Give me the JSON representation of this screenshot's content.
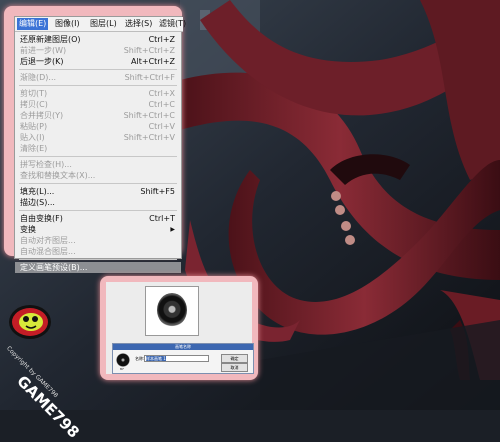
{
  "menubar": {
    "items": [
      {
        "label": "编辑(E)",
        "active": true
      },
      {
        "label": "图像(I)",
        "active": false
      },
      {
        "label": "图层(L)",
        "active": false
      },
      {
        "label": "选择(S)",
        "active": false
      },
      {
        "label": "滤镜(T)",
        "active": false
      }
    ]
  },
  "menu": {
    "items": [
      {
        "label": "还原新建图层(O)",
        "shortcut": "Ctrl+Z",
        "disabled": false
      },
      {
        "label": "前进一步(W)",
        "shortcut": "Shift+Ctrl+Z",
        "disabled": true
      },
      {
        "label": "后退一步(K)",
        "shortcut": "Alt+Ctrl+Z",
        "disabled": false
      },
      {
        "sep": true
      },
      {
        "label": "渐隐(D)...",
        "shortcut": "Shift+Ctrl+F",
        "disabled": true
      },
      {
        "sep": true
      },
      {
        "label": "剪切(T)",
        "shortcut": "Ctrl+X",
        "disabled": true
      },
      {
        "label": "拷贝(C)",
        "shortcut": "Ctrl+C",
        "disabled": true
      },
      {
        "label": "合并拷贝(Y)",
        "shortcut": "Shift+Ctrl+C",
        "disabled": true
      },
      {
        "label": "粘贴(P)",
        "shortcut": "Ctrl+V",
        "disabled": true
      },
      {
        "label": "贴入(I)",
        "shortcut": "Shift+Ctrl+V",
        "disabled": true
      },
      {
        "label": "清除(E)",
        "shortcut": "",
        "disabled": true
      },
      {
        "sep": true
      },
      {
        "label": "拼写检查(H)...",
        "shortcut": "",
        "disabled": true
      },
      {
        "label": "查找和替换文本(X)...",
        "shortcut": "",
        "disabled": true
      },
      {
        "sep": true
      },
      {
        "label": "填充(L)...",
        "shortcut": "Shift+F5",
        "disabled": false
      },
      {
        "label": "描边(S)...",
        "shortcut": "",
        "disabled": false
      },
      {
        "sep": true
      },
      {
        "label": "自由变换(F)",
        "shortcut": "Ctrl+T",
        "disabled": false
      },
      {
        "label": "变换",
        "shortcut": "",
        "disabled": false,
        "submenu": true
      },
      {
        "label": "自动对齐图层...",
        "shortcut": "",
        "disabled": true
      },
      {
        "label": "自动混合图层...",
        "shortcut": "",
        "disabled": true
      },
      {
        "sep": true
      },
      {
        "label": "定义画笔预设(B)...",
        "shortcut": "",
        "disabled": false,
        "highlighted": true
      }
    ]
  },
  "dialog": {
    "title": "画笔名称",
    "name_label": "名称:",
    "name_value": "样本画笔 1",
    "ok_label": "确定",
    "cancel_label": "取消",
    "size_text": "87"
  },
  "watermark": {
    "brand": "GAME798",
    "copyright": "Copyright by GAME798"
  },
  "colors": {
    "frame_glow": "#f1b8bd",
    "highlight": "#8d8f93",
    "selection": "#3b73d6"
  }
}
